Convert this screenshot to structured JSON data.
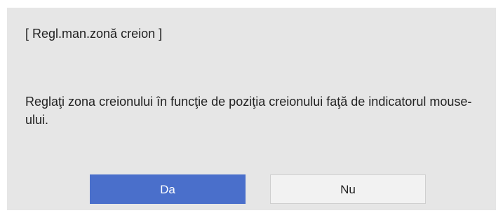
{
  "dialog": {
    "title": "[ Regl.man.zonă creion ]",
    "message": "Reglaţi zona creionului în funcţie de poziţia creionului faţă de indicatorul mouse-ului.",
    "buttons": {
      "yes_label": "Da",
      "no_label": "Nu"
    },
    "colors": {
      "background": "#e6e6e6",
      "primary_button": "#4a6fcb",
      "secondary_button": "#f2f2f2"
    }
  }
}
